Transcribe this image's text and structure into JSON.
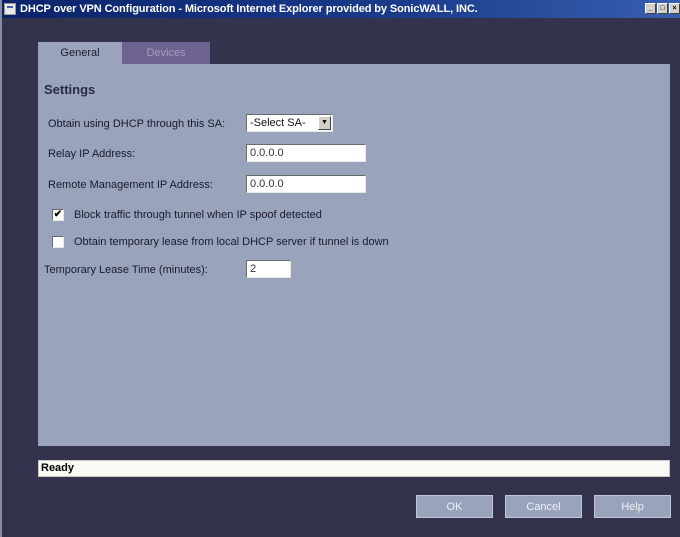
{
  "window": {
    "title": "DHCP over VPN Configuration - Microsoft Internet Explorer provided by SonicWALL, INC.",
    "controls": [
      "_",
      "□",
      "×"
    ]
  },
  "tabs": [
    {
      "label": "General",
      "active": true
    },
    {
      "label": "Devices",
      "active": false
    }
  ],
  "settings": {
    "title": "Settings",
    "sa_label": "Obtain using DHCP through this SA:",
    "sa_value": "-Select SA-",
    "relay_label": "Relay IP Address:",
    "relay_value": "0.0.0.0",
    "remote_label": "Remote Management IP Address:",
    "remote_value": "0.0.0.0",
    "block_label": "Block traffic through tunnel when IP spoof detected",
    "block_checked": true,
    "block_mark": "✔",
    "temp_lease_label": "Obtain temporary lease from local DHCP server if tunnel is down",
    "temp_lease_checked": false,
    "lease_time_label": "Temporary Lease Time (minutes):",
    "lease_time_value": "2"
  },
  "status": {
    "text": "Ready"
  },
  "buttons": {
    "ok": "OK",
    "cancel": "Cancel",
    "help": "Help"
  },
  "icons": {
    "select_arrow": "▼"
  },
  "colors": {
    "panel": "#9aa3bc",
    "background": "#33334d",
    "inactive_tab": "#6e6390"
  }
}
